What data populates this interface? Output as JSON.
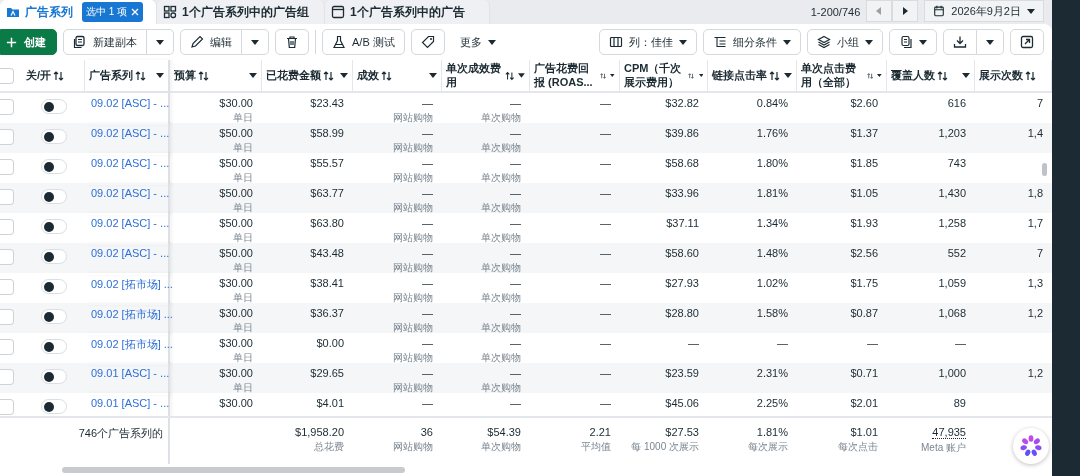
{
  "tabs": [
    {
      "label": "广告系列",
      "selected": true,
      "badge": "选中 1 项"
    },
    {
      "label": "1个广告系列中的广告组",
      "selected": false
    },
    {
      "label": "1个广告系列中的广告",
      "selected": false
    }
  ],
  "pagination": "1-200/746",
  "date": "2026年9月2日",
  "toolbar": {
    "create": "创建",
    "duplicate": "新建副本",
    "edit": "编辑",
    "ab_test": "A/B 测试",
    "more": "更多",
    "columns": "列：佳佳",
    "breakdown": "细分条件",
    "group": "小组"
  },
  "header_checked": false,
  "columns": [
    {
      "label": "关/开",
      "menu": false
    },
    {
      "label": "广告系列",
      "menu": true
    },
    {
      "label": "预算",
      "menu": true
    },
    {
      "label": "已花费金额",
      "menu": true
    },
    {
      "label": "成效",
      "menu": true
    },
    {
      "label": "单次成效费用",
      "menu": true
    },
    {
      "label": "广告花费回报 (ROAS...",
      "menu": true
    },
    {
      "label": "CPM（千次展示费用）",
      "menu": true
    },
    {
      "label": "链接点击率",
      "menu": true
    },
    {
      "label": "单次点击费用（全部）",
      "menu": true
    },
    {
      "label": "覆盖人数",
      "menu": true
    },
    {
      "label": "展示次数",
      "menu": false
    }
  ],
  "rows": [
    {
      "checked": false,
      "on": false,
      "name": "09.02 [ASC] - ...",
      "cells": [
        {
          "text": "$30.00",
          "sub": "单日"
        },
        {
          "text": "$23.43"
        },
        {
          "text": "—",
          "sub": "网站购物"
        },
        {
          "text": "—",
          "sub": "单次购物"
        },
        {
          "text": "—"
        },
        {
          "text": "$32.82"
        },
        {
          "text": "0.84%"
        },
        {
          "text": "$2.60"
        },
        {
          "text": "616"
        },
        {
          "text": "7"
        }
      ]
    },
    {
      "checked": false,
      "on": false,
      "name": "09.02 [ASC] - ...",
      "cells": [
        {
          "text": "$50.00",
          "sub": "单日"
        },
        {
          "text": "$58.99"
        },
        {
          "text": "—",
          "sub": "网站购物"
        },
        {
          "text": "—",
          "sub": "单次购物"
        },
        {
          "text": "—"
        },
        {
          "text": "$39.86"
        },
        {
          "text": "1.76%"
        },
        {
          "text": "$1.37"
        },
        {
          "text": "1,203"
        },
        {
          "text": "1,4"
        }
      ]
    },
    {
      "checked": false,
      "on": false,
      "name": "09.02 [ASC] - ...",
      "cells": [
        {
          "text": "$50.00",
          "sub": "单日"
        },
        {
          "text": "$55.57"
        },
        {
          "text": "—",
          "sub": "网站购物"
        },
        {
          "text": "—",
          "sub": "单次购物"
        },
        {
          "text": "—"
        },
        {
          "text": "$58.68"
        },
        {
          "text": "1.80%"
        },
        {
          "text": "$1.85"
        },
        {
          "text": "743"
        }
      ]
    },
    {
      "checked": false,
      "on": false,
      "name": "09.02 [ASC] - ...",
      "cells": [
        {
          "text": "$50.00",
          "sub": "单日"
        },
        {
          "text": "$63.77"
        },
        {
          "text": "—",
          "sub": "网站购物"
        },
        {
          "text": "—",
          "sub": "单次购物"
        },
        {
          "text": "—"
        },
        {
          "text": "$33.96"
        },
        {
          "text": "1.81%"
        },
        {
          "text": "$1.05"
        },
        {
          "text": "1,430"
        },
        {
          "text": "1,8"
        }
      ]
    },
    {
      "checked": false,
      "on": false,
      "name": "09.02 [ASC] - ...",
      "cells": [
        {
          "text": "$50.00",
          "sub": "单日"
        },
        {
          "text": "$63.80"
        },
        {
          "text": "—",
          "sub": "网站购物"
        },
        {
          "text": "—",
          "sub": "单次购物"
        },
        {
          "text": "—"
        },
        {
          "text": "$37.11"
        },
        {
          "text": "1.34%"
        },
        {
          "text": "$1.93"
        },
        {
          "text": "1,258"
        },
        {
          "text": "1,7"
        }
      ]
    },
    {
      "checked": false,
      "on": false,
      "name": "09.02 [ASC] - ...",
      "cells": [
        {
          "text": "$50.00",
          "sub": "单日"
        },
        {
          "text": "$43.48"
        },
        {
          "text": "—",
          "sub": "网站购物"
        },
        {
          "text": "—",
          "sub": "单次购物"
        },
        {
          "text": "—"
        },
        {
          "text": "$58.60"
        },
        {
          "text": "1.48%"
        },
        {
          "text": "$2.56"
        },
        {
          "text": "552"
        },
        {
          "text": "7"
        }
      ]
    },
    {
      "checked": false,
      "on": false,
      "name": "09.02 [拓市场] ...",
      "cells": [
        {
          "text": "$30.00",
          "sub": "单日"
        },
        {
          "text": "$38.41"
        },
        {
          "text": "—",
          "sub": "网站购物"
        },
        {
          "text": "—",
          "sub": "单次购物"
        },
        {
          "text": "—"
        },
        {
          "text": "$27.93"
        },
        {
          "text": "1.02%"
        },
        {
          "text": "$1.75"
        },
        {
          "text": "1,059"
        },
        {
          "text": "1,3"
        }
      ]
    },
    {
      "checked": false,
      "on": false,
      "name": "09.02 [拓市场] ...",
      "cells": [
        {
          "text": "$30.00",
          "sub": "单日"
        },
        {
          "text": "$36.37"
        },
        {
          "text": "—",
          "sub": "网站购物"
        },
        {
          "text": "—",
          "sub": "单次购物"
        },
        {
          "text": "—"
        },
        {
          "text": "$28.80"
        },
        {
          "text": "1.58%"
        },
        {
          "text": "$0.87"
        },
        {
          "text": "1,068"
        },
        {
          "text": "1,2"
        }
      ]
    },
    {
      "checked": false,
      "on": false,
      "name": "09.02 [拓市场] ...",
      "cells": [
        {
          "text": "$30.00",
          "sub": "单日"
        },
        {
          "text": "$0.00"
        },
        {
          "text": "—",
          "sub": "网站购物"
        },
        {
          "text": "—",
          "sub": "单次购物"
        },
        {
          "text": "—"
        },
        {
          "text": "—"
        },
        {
          "text": "—"
        },
        {
          "text": "—"
        },
        {
          "text": "—"
        }
      ]
    },
    {
      "checked": false,
      "on": false,
      "name": "09.01 [ASC] - ...",
      "cells": [
        {
          "text": "$30.00",
          "sub": "单日"
        },
        {
          "text": "$29.65"
        },
        {
          "text": "—",
          "sub": "网站购物"
        },
        {
          "text": "—",
          "sub": "单次购物"
        },
        {
          "text": "—"
        },
        {
          "text": "$23.59"
        },
        {
          "text": "2.31%"
        },
        {
          "text": "$0.71"
        },
        {
          "text": "1,000"
        },
        {
          "text": "1,2"
        }
      ]
    },
    {
      "checked": false,
      "on": false,
      "name": "09.01 [ASC] - ...",
      "cells": [
        {
          "text": "$30.00"
        },
        {
          "text": "$4.01"
        },
        {
          "text": "—"
        },
        {
          "text": "—"
        },
        {
          "text": "—"
        },
        {
          "text": "$45.06"
        },
        {
          "text": "2.25%"
        },
        {
          "text": "$2.01"
        },
        {
          "text": "89"
        }
      ]
    }
  ],
  "footer": {
    "label": "746个广告系列的",
    "totals": [
      {
        "text": "$1,958.20",
        "sub": "总花费"
      },
      {
        "text": "36",
        "sub": "网站购物"
      },
      {
        "text": "$54.39",
        "sub": "单次购物"
      },
      {
        "text": "2.21",
        "sub": "平均值"
      },
      {
        "text": "$27.53",
        "sub": "每 1000 次展示"
      },
      {
        "text": "1.81%",
        "sub": "每次展示"
      },
      {
        "text": "$1.01",
        "sub": "每次点击"
      },
      {
        "text": "47,935",
        "sub": "Meta 账户"
      }
    ]
  }
}
